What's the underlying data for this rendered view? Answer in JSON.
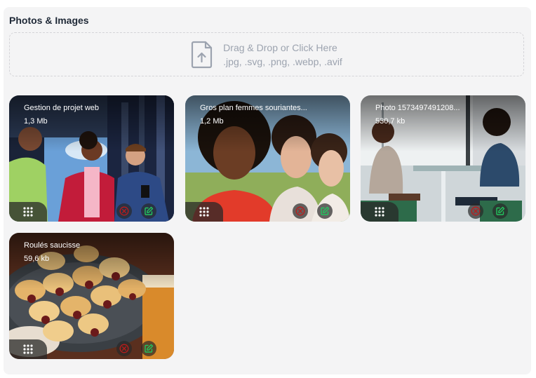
{
  "section": {
    "title": "Photos & Images"
  },
  "dropzone": {
    "line1": "Drag & Drop or Click Here",
    "line2": ".jpg, .svg, .png, .webp, .avif"
  },
  "images": [
    {
      "name": "Gestion de projet web",
      "size": "1,3 Mb"
    },
    {
      "name": "Gros plan femmes souriantes...",
      "size": "1,2 Mb"
    },
    {
      "name": "Photo 1573497491208...",
      "size": "530,7 kb"
    },
    {
      "name": "Roulés saucisse",
      "size": "59,6 kb"
    }
  ],
  "colors": {
    "delete_icon": "#b91c1c",
    "edit_icon": "#22c55e"
  },
  "icons": {
    "upload": "file-upload-icon",
    "drag": "drag-handle-icon",
    "delete": "remove-circle-icon",
    "edit": "edit-icon"
  }
}
